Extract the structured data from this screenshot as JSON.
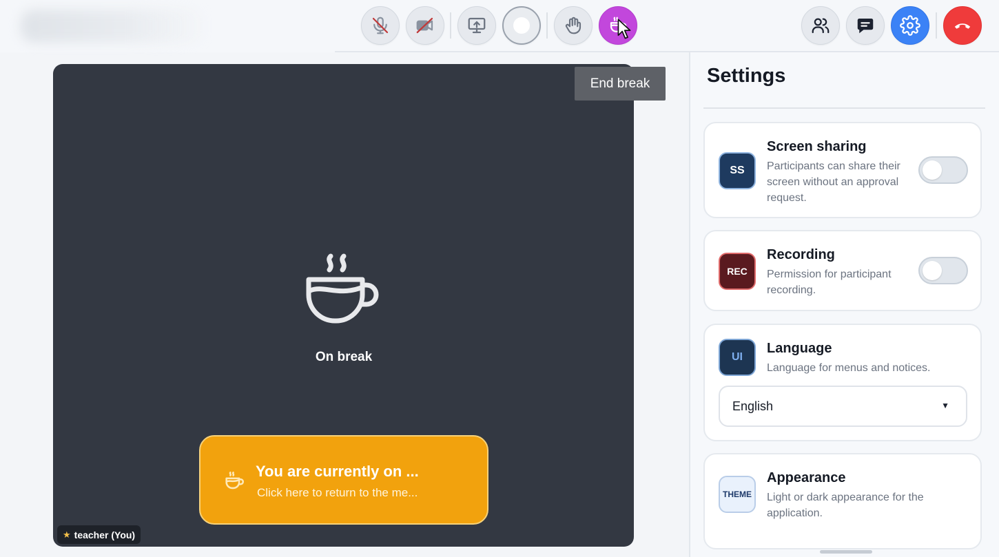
{
  "toolbar": {
    "buttons": [
      {
        "name": "mic",
        "label": "Microphone muted",
        "icon": "mic-off-icon"
      },
      {
        "name": "camera",
        "label": "Camera off",
        "icon": "camera-off-icon"
      },
      {
        "name": "screen-share",
        "label": "Share screen",
        "icon": "screen-share-icon"
      },
      {
        "name": "record",
        "label": "Record",
        "icon": "record-icon"
      },
      {
        "name": "raise-hand",
        "label": "Raise hand",
        "icon": "hand-icon"
      },
      {
        "name": "break",
        "label": "Break",
        "icon": "coffee-cup-icon",
        "color": "#c247dc"
      },
      {
        "name": "participants",
        "label": "Participants",
        "icon": "people-icon"
      },
      {
        "name": "chat",
        "label": "Chat",
        "icon": "chat-icon"
      },
      {
        "name": "settings",
        "label": "Settings",
        "icon": "gear-icon",
        "color": "#3b82f6"
      },
      {
        "name": "leave",
        "label": "Leave call",
        "icon": "phone-hangup-icon",
        "color": "#ef3b3b"
      }
    ]
  },
  "tooltip": {
    "text": "End break"
  },
  "video": {
    "status_label": "On break",
    "banner": {
      "title": "You are currently on ...",
      "subtitle": "Click here to return to the me...",
      "color": "#f2a20d"
    },
    "participant": {
      "name": "teacher (You)",
      "star": "★"
    }
  },
  "settings": {
    "title": "Settings",
    "cards": [
      {
        "badge": "SS",
        "title": "Screen sharing",
        "description": "Participants can share their screen without an approval request.",
        "toggle": false
      },
      {
        "badge": "REC",
        "title": "Recording",
        "description": "Permission for participant recording.",
        "toggle": false
      },
      {
        "badge": "UI",
        "title": "Language",
        "description": "Language for menus and notices.",
        "select_value": "English"
      },
      {
        "badge": "THEME",
        "title": "Appearance",
        "description": "Light or dark appearance for the application."
      }
    ]
  }
}
